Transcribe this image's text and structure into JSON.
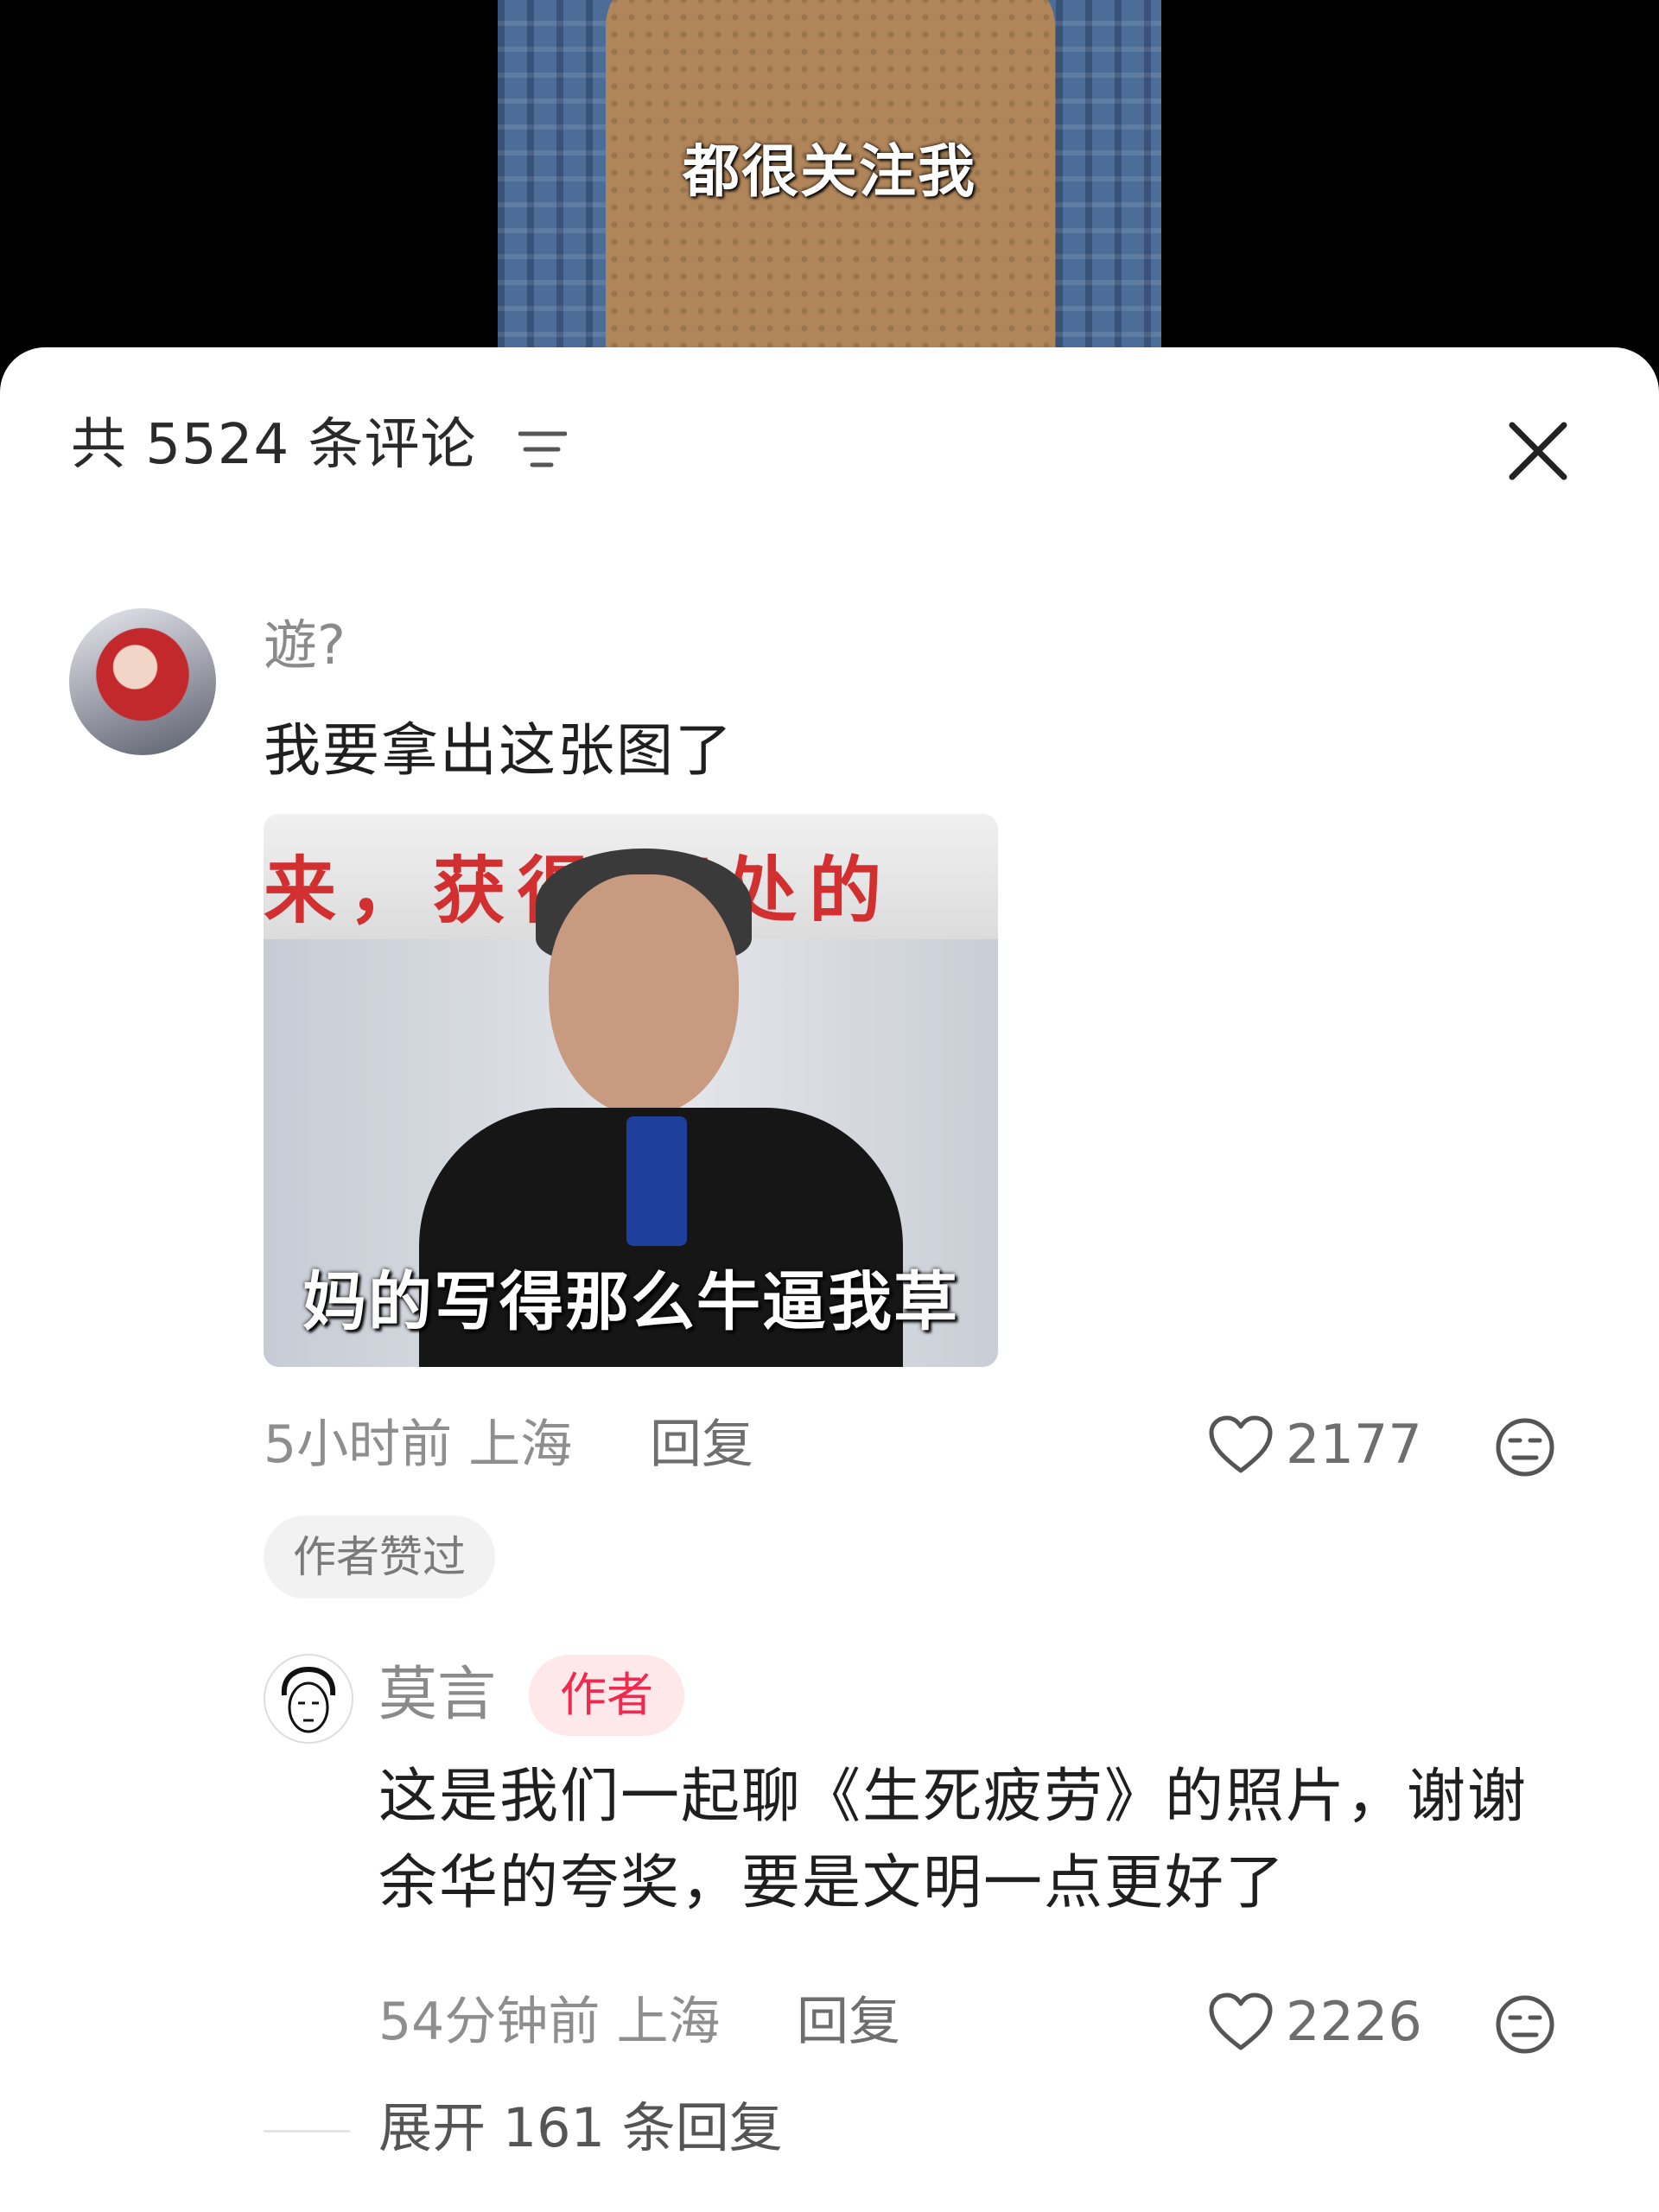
{
  "video": {
    "subtitle": "都很关注我"
  },
  "header": {
    "title": "共 5524 条评论",
    "filter_icon": "filter-icon",
    "close_icon": "close-icon"
  },
  "comments": [
    {
      "username": "遊?",
      "text": "我要拿出这张图了",
      "image": {
        "banner_text": "来，获得 深处的",
        "caption": "妈的写得那么牛逼我草"
      },
      "time": "5小时前",
      "location": "上海",
      "reply_label": "回复",
      "likes": "2177",
      "badge": "作者赞过",
      "replies": [
        {
          "username": "莫言",
          "tag": "作者",
          "text": "这是我们一起聊《生死疲劳》的照片，谢谢余华的夸奖，要是文明一点更好了",
          "time": "54分钟前",
          "location": "上海",
          "reply_label": "回复",
          "likes": "2226"
        }
      ],
      "expand_label": "展开 161 条回复"
    }
  ],
  "colors": {
    "author_tag_bg": "#ffe8ea",
    "author_tag_text": "#ee2a4f",
    "meme_banner_text": "#d23030"
  }
}
